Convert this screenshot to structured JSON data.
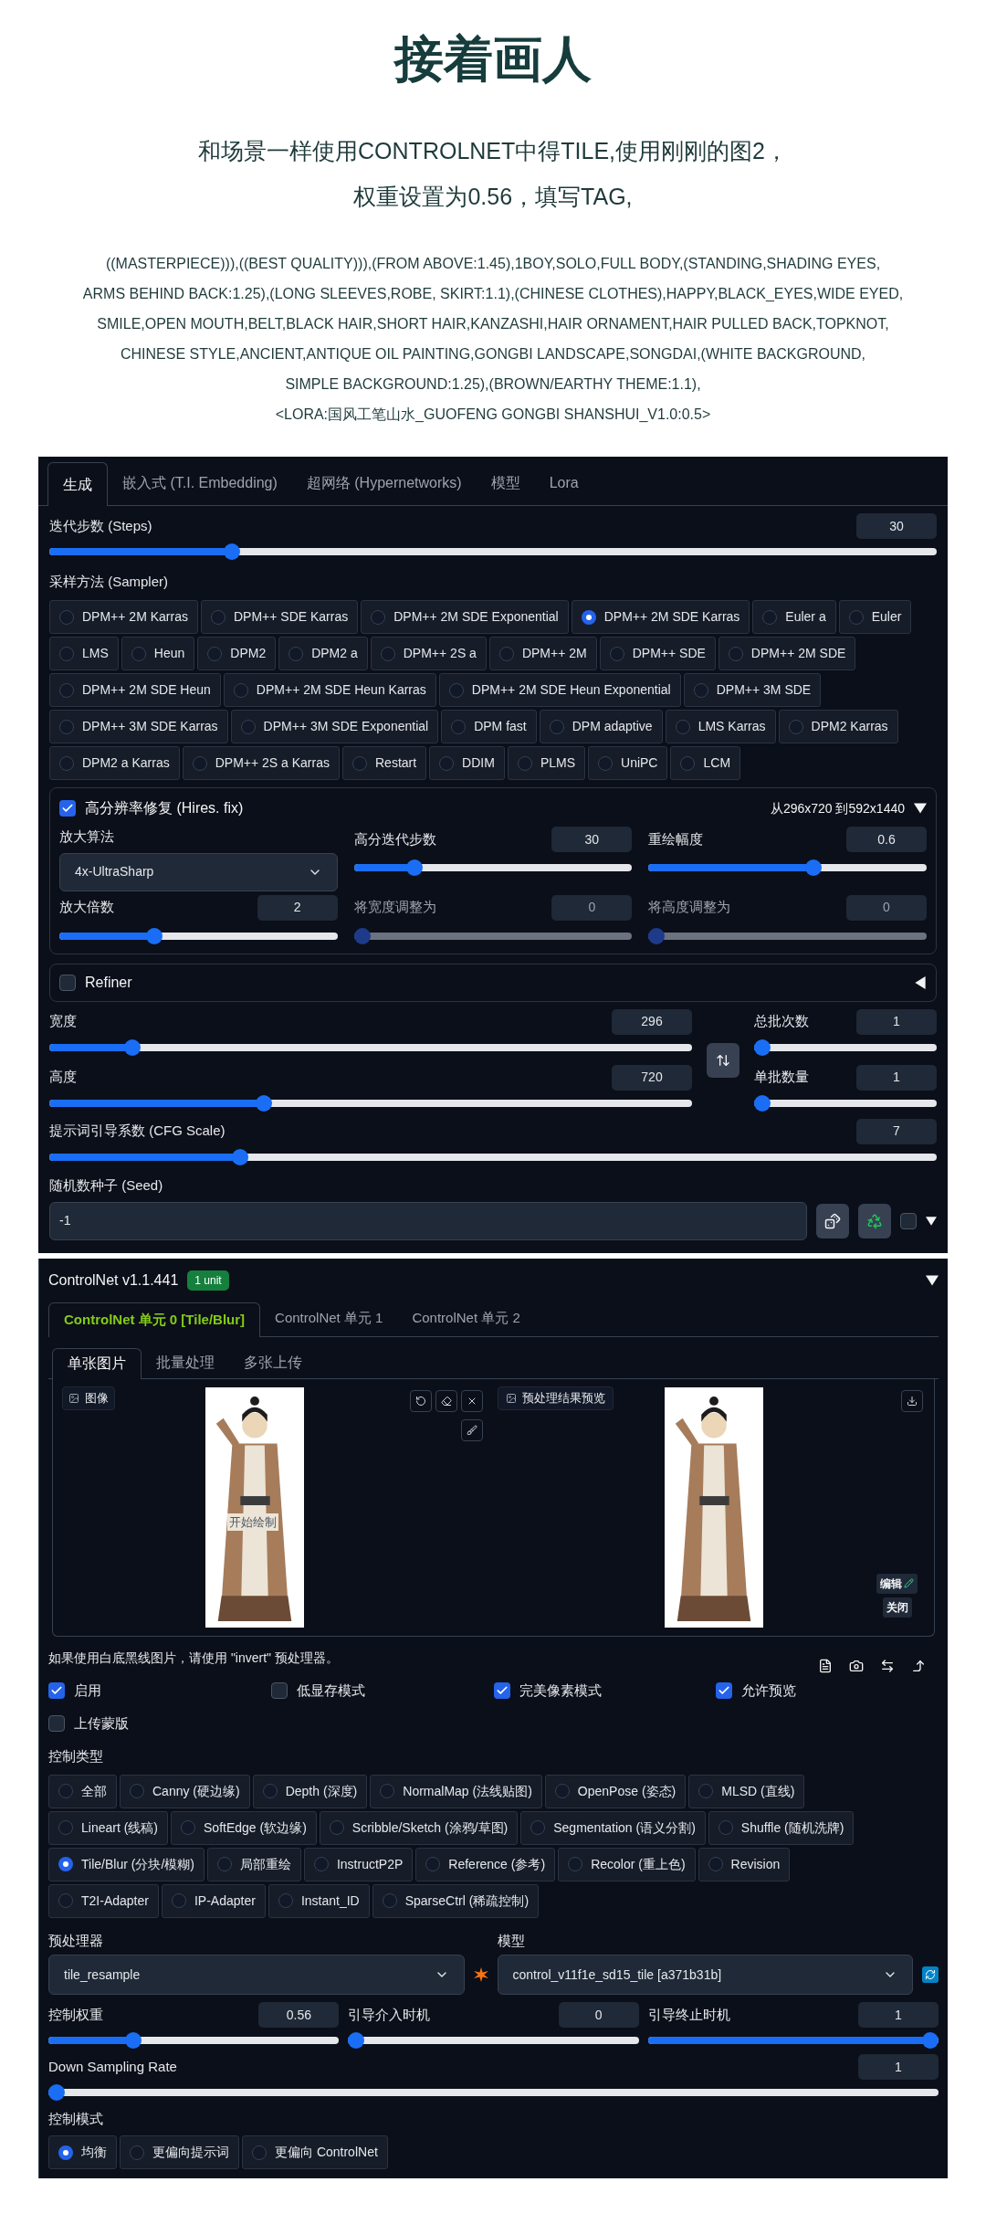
{
  "article": {
    "title": "接着画人",
    "intro_lines": [
      "和场景一样使用CONTROLNET中得TILE,使用刚刚的图2，",
      "权重设置为0.56，填写TAG,"
    ],
    "prompt": "((MASTERPIECE))),((BEST QUALITY))),(FROM ABOVE:1.45),1BOY,SOLO,FULL BODY,(STANDING,SHADING EYES,\nARMS BEHIND BACK:1.25),(LONG SLEEVES,ROBE, SKIRT:1.1),(CHINESE CLOTHES),HAPPY,BLACK_EYES,WIDE EYED,\nSMILE,OPEN MOUTH,BELT,BLACK HAIR,SHORT HAIR,KANZASHI,HAIR ORNAMENT,HAIR PULLED BACK,TOPKNOT,\nCHINESE STYLE,ANCIENT,ANTIQUE OIL PAINTING,GONGBI LANDSCAPE,SONGDAI,(WHITE BACKGROUND,\nSIMPLE BACKGROUND:1.25),(BROWN/EARTHY THEME:1.1),\n<LORA:国风工笔山水_GUOFENG GONGBI SHANSHUI_V1.0:0.5>"
  },
  "generation": {
    "tabs": [
      {
        "label": "生成",
        "selected": true
      },
      {
        "label": "嵌入式 (T.I. Embedding)",
        "selected": false
      },
      {
        "label": "超网络 (Hypernetworks)",
        "selected": false
      },
      {
        "label": "模型",
        "selected": false
      },
      {
        "label": "Lora",
        "selected": false
      }
    ],
    "steps": {
      "label": "迭代步数 (Steps)",
      "value": "30",
      "level": 0.2
    },
    "sampler": {
      "label": "采样方法 (Sampler)",
      "options": [
        {
          "label": "DPM++ 2M Karras",
          "selected": false
        },
        {
          "label": "DPM++ SDE Karras",
          "selected": false
        },
        {
          "label": "DPM++ 2M SDE Exponential",
          "selected": false
        },
        {
          "label": "DPM++ 2M SDE Karras",
          "selected": true
        },
        {
          "label": "Euler a",
          "selected": false
        },
        {
          "label": "Euler",
          "selected": false
        },
        {
          "label": "LMS",
          "selected": false
        },
        {
          "label": "Heun",
          "selected": false
        },
        {
          "label": "DPM2",
          "selected": false
        },
        {
          "label": "DPM2 a",
          "selected": false
        },
        {
          "label": "DPM++ 2S a",
          "selected": false
        },
        {
          "label": "DPM++ 2M",
          "selected": false
        },
        {
          "label": "DPM++ SDE",
          "selected": false
        },
        {
          "label": "DPM++ 2M SDE",
          "selected": false
        },
        {
          "label": "DPM++ 2M SDE Heun",
          "selected": false
        },
        {
          "label": "DPM++ 2M SDE Heun Karras",
          "selected": false
        },
        {
          "label": "DPM++ 2M SDE Heun Exponential",
          "selected": false
        },
        {
          "label": "DPM++ 3M SDE",
          "selected": false
        },
        {
          "label": "DPM++ 3M SDE Karras",
          "selected": false
        },
        {
          "label": "DPM++ 3M SDE Exponential",
          "selected": false
        },
        {
          "label": "DPM fast",
          "selected": false
        },
        {
          "label": "DPM adaptive",
          "selected": false
        },
        {
          "label": "LMS Karras",
          "selected": false
        },
        {
          "label": "DPM2 Karras",
          "selected": false
        },
        {
          "label": "DPM2 a Karras",
          "selected": false
        },
        {
          "label": "DPM++ 2S a Karras",
          "selected": false
        },
        {
          "label": "Restart",
          "selected": false
        },
        {
          "label": "DDIM",
          "selected": false
        },
        {
          "label": "PLMS",
          "selected": false
        },
        {
          "label": "UniPC",
          "selected": false
        },
        {
          "label": "LCM",
          "selected": false
        }
      ]
    },
    "hires_fix": {
      "label": "高分辨率修复 (Hires. fix)",
      "checked": true,
      "summary": "从296x720 到592x1440",
      "expanded": true,
      "upscaler": {
        "label": "放大算法",
        "value": "4x-UltraSharp"
      },
      "sliders": [
        {
          "label": "高分迭代步数",
          "value": "30",
          "level": 0.2,
          "disabled": false
        },
        {
          "label": "重绘幅度",
          "value": "0.6",
          "level": 0.6,
          "disabled": false
        },
        {
          "label": "放大倍数",
          "value": "2",
          "level": 0.33,
          "disabled": false
        },
        {
          "label": "将宽度调整为",
          "value": "0",
          "level": 0,
          "disabled": true
        },
        {
          "label": "将高度调整为",
          "value": "0",
          "level": 0,
          "disabled": true
        }
      ]
    },
    "refiner": {
      "label": "Refiner",
      "checked": false,
      "expanded": false
    },
    "size": [
      {
        "label": "宽度",
        "value": "296",
        "level": 0.12
      },
      {
        "label": "高度",
        "value": "720",
        "level": 0.33
      }
    ],
    "batch": [
      {
        "label": "总批次数",
        "value": "1",
        "level": 0
      },
      {
        "label": "单批数量",
        "value": "1",
        "level": 0
      }
    ],
    "cfg": {
      "label": "提示词引导系数 (CFG Scale)",
      "value": "7",
      "level": 0.21
    },
    "seed": {
      "label": "随机数种子 (Seed)",
      "value": "-1",
      "extra_checked": false
    }
  },
  "controlnet": {
    "title": "ControlNet v1.1.441",
    "badge": "1 unit",
    "expanded": true,
    "unit_tabs": [
      {
        "label": "ControlNet 单元 0 [Tile/Blur]",
        "selected": true
      },
      {
        "label": "ControlNet 单元 1",
        "selected": false
      },
      {
        "label": "ControlNet 单元 2",
        "selected": false
      }
    ],
    "input_tabs": [
      {
        "label": "单张图片",
        "selected": true
      },
      {
        "label": "批量处理",
        "selected": false
      },
      {
        "label": "多张上传",
        "selected": false
      }
    ],
    "image_label": "图像",
    "canvas_hint": "开始绘制",
    "preview_label": "预处理结果预览",
    "edit_button": "编辑",
    "close_button": "关闭",
    "hint": "如果使用白底黑线图片，请使用 \"invert\" 预处理器。",
    "options": [
      {
        "label": "启用",
        "checked": true
      },
      {
        "label": "低显存模式",
        "checked": false
      },
      {
        "label": "完美像素模式",
        "checked": true
      },
      {
        "label": "允许预览",
        "checked": true
      },
      {
        "label": "上传蒙版",
        "checked": false
      }
    ],
    "control_type": {
      "label": "控制类型",
      "options": [
        {
          "label": "全部",
          "selected": false
        },
        {
          "label": "Canny (硬边缘)",
          "selected": false
        },
        {
          "label": "Depth (深度)",
          "selected": false
        },
        {
          "label": "NormalMap (法线贴图)",
          "selected": false
        },
        {
          "label": "OpenPose (姿态)",
          "selected": false
        },
        {
          "label": "MLSD (直线)",
          "selected": false
        },
        {
          "label": "Lineart (线稿)",
          "selected": false
        },
        {
          "label": "SoftEdge (软边缘)",
          "selected": false
        },
        {
          "label": "Scribble/Sketch (涂鸦/草图)",
          "selected": false
        },
        {
          "label": "Segmentation (语义分割)",
          "selected": false
        },
        {
          "label": "Shuffle (随机洗牌)",
          "selected": false
        },
        {
          "label": "Tile/Blur (分块/模糊)",
          "selected": true
        },
        {
          "label": "局部重绘",
          "selected": false
        },
        {
          "label": "InstructP2P",
          "selected": false
        },
        {
          "label": "Reference (参考)",
          "selected": false
        },
        {
          "label": "Recolor (重上色)",
          "selected": false
        },
        {
          "label": "Revision",
          "selected": false
        },
        {
          "label": "T2I-Adapter",
          "selected": false
        },
        {
          "label": "IP-Adapter",
          "selected": false
        },
        {
          "label": "Instant_ID",
          "selected": false
        },
        {
          "label": "SparseCtrl (稀疏控制)",
          "selected": false
        }
      ]
    },
    "preprocessor": {
      "label": "预处理器",
      "value": "tile_resample"
    },
    "model": {
      "label": "模型",
      "value": "control_v11f1e_sd15_tile [a371b31b]"
    },
    "sliders": [
      {
        "label": "控制权重",
        "value": "0.56",
        "level": 0.28
      },
      {
        "label": "引导介入时机",
        "value": "0",
        "level": 0
      },
      {
        "label": "引导终止时机",
        "value": "1",
        "level": 1
      }
    ],
    "down_sampling": {
      "label": "Down Sampling Rate",
      "value": "1",
      "level": 0
    },
    "control_mode": {
      "label": "控制模式",
      "options": [
        {
          "label": "均衡",
          "selected": true
        },
        {
          "label": "更偏向提示词",
          "selected": false
        },
        {
          "label": "更偏向 ControlNet",
          "selected": false
        }
      ]
    }
  }
}
